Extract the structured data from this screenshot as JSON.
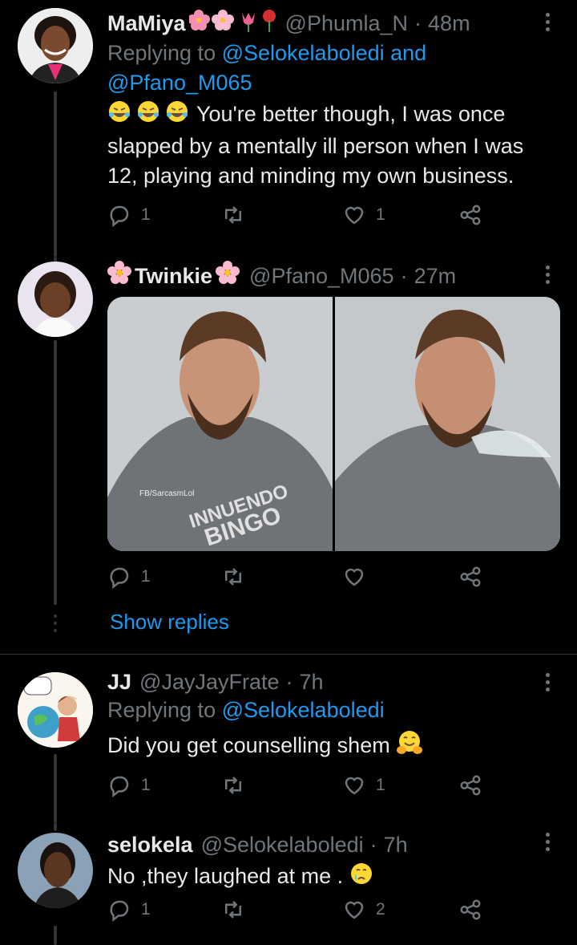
{
  "tweets": [
    {
      "name": "MaMiya",
      "handle": "@Phumla_N",
      "time": "48m",
      "reply_prefix": "Replying to ",
      "reply_to_1": "@Selokelaboledi",
      "reply_and": " and",
      "reply_to_2": "@Pfano_M065",
      "text_l1": "You're better though, I was once",
      "text_l2": "slapped by a mentally ill person when I was",
      "text_l3": "12, playing and minding my own business.",
      "replies": "1",
      "retweets": "",
      "likes": "1"
    },
    {
      "name": "Twinkie",
      "handle": "@Pfano_M065",
      "time": "27m",
      "media_watermark": "FB/SarcasmLol",
      "media_shirt_1": "INNUENDO",
      "media_shirt_2": "BINGO",
      "replies": "1",
      "retweets": "",
      "likes": ""
    },
    {
      "name": "JJ",
      "handle": "@JayJayFrate",
      "time": "7h",
      "reply_prefix": "Replying to ",
      "reply_to_1": "@Selokelaboledi",
      "text_l1": "Did you get counselling shem",
      "replies": "1",
      "retweets": "",
      "likes": "1"
    },
    {
      "name": "selokela",
      "handle": "@Selokelaboledi",
      "time": "7h",
      "text_l1": "No ,they laughed at me .",
      "replies": "1",
      "retweets": "",
      "likes": "2"
    }
  ],
  "show_replies": "Show replies",
  "icons": [
    "reply-icon",
    "retweet-icon",
    "like-icon",
    "share-icon",
    "more-icon"
  ],
  "colors": {
    "background": "#000000",
    "text": "#e7e9ea",
    "muted": "#71767b",
    "link": "#1d9bf0"
  }
}
